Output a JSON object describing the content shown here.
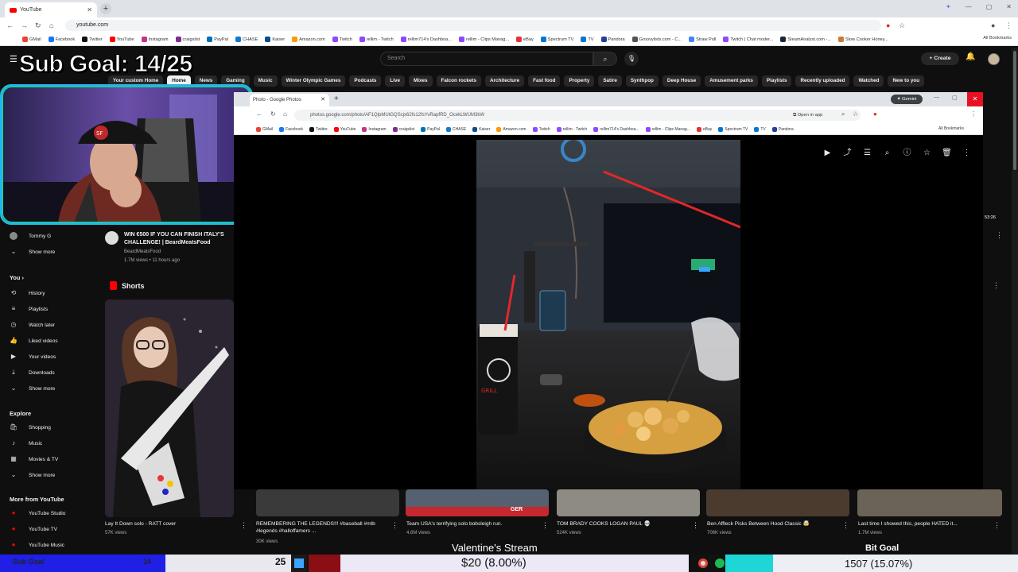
{
  "browser": {
    "tab_title": "YouTube",
    "url": "youtube.com",
    "bookmarks": [
      "GMail",
      "Facebook",
      "Twitter",
      "YouTube",
      "Instagram",
      "craigslist",
      "PayPal",
      "CHASE",
      "Kaiser",
      "Amazon.com",
      "Twitch",
      "rellim - Twitch",
      "rellim714's Dashboa...",
      "rellim - Clips Manag...",
      "eBay",
      "Spectrum TV",
      "TV",
      "Pandora",
      "Groovylists.com - C...",
      "Straw Poll",
      "Twitch | Chat moder...",
      "SteamAnalyst.com -...",
      "Slow Cooker Honey..."
    ],
    "all_bookmarks": "All Bookmarks"
  },
  "youtube": {
    "search_placeholder": "Search",
    "create_label": "Create",
    "chips": [
      "Your custom Home",
      "Home",
      "News",
      "Gaming",
      "Music",
      "Winter Olympic Games",
      "Podcasts",
      "Live",
      "Mixes",
      "Falcon rockets",
      "Architecture",
      "Fast food",
      "Property",
      "Satire",
      "Synthpop",
      "Deep House",
      "Amusement parks",
      "Playlists",
      "Recently uploaded",
      "Watched",
      "New to you"
    ],
    "active_chip_index": 1,
    "sidebar": {
      "subscription": "Tommy G",
      "show_more_1": "Show more",
      "you_heading": "You",
      "you_items": [
        "History",
        "Playlists",
        "Watch later",
        "Liked videos",
        "Your videos",
        "Downloads",
        "Show more"
      ],
      "explore_heading": "Explore",
      "explore_items": [
        "Shopping",
        "Music",
        "Movies & TV",
        "Show more"
      ],
      "more_heading": "More from YouTube",
      "more_items": [
        "YouTube Studio",
        "YouTube TV",
        "YouTube Music"
      ]
    },
    "featured": {
      "title": "WIN €500 IF YOU CAN FINISH ITALY'S CHALLENGE! | BeardMeatsFood",
      "channel": "BeardMeatsFood",
      "meta": "1.7M views • 11 hours ago"
    },
    "right_duration": "53:26",
    "shorts_heading": "Shorts",
    "shorts": [
      {
        "title": "Lay It Down solo - RATT cover",
        "views": "57K views"
      },
      {
        "title": "REMEMBERING THE LEGENDS!!! #baseball #mlb #legends #halloffamers ...",
        "views": "30K views"
      },
      {
        "title": "Team USA's terrifying solo bobsleigh run.",
        "views": "4.6M views"
      },
      {
        "title": "TOM BRADY COOKS LOGAN PAUL 💀",
        "views": "524K views"
      },
      {
        "title": "Ben Affleck Picks Between Hood Classic 🤯",
        "views": "706K views"
      },
      {
        "title": "Last time I showed this, people HATED it...",
        "views": "1.7M views"
      }
    ]
  },
  "overlay": {
    "sub_goal": "Sub Goal: 14/25",
    "bottom_bar": {
      "left_label": "Sub Goal",
      "left_count": "14",
      "sub_target": "25",
      "money": "$20 (8.00%)",
      "bits": "1507 (15.07%)",
      "valentines": "Valentine's Stream",
      "bit_goal": "Bit Goal"
    }
  },
  "photos_window": {
    "tab_title": "Photo - Google Photos",
    "url": "photos.google.com/photo/AF1QipMUtGQScjx62fs12fsYvRapfRD_OcekLWUM3kW",
    "gemini_label": "Gemini",
    "open_in_app": "Open in app",
    "bookmarks": [
      "GMail",
      "Facebook",
      "Twitter",
      "YouTube",
      "Instagram",
      "craigslist",
      "PayPal",
      "CHASE",
      "Kaiser",
      "Amazon.com",
      "Twitch",
      "rellim - Twitch",
      "rellim714's Dashboa...",
      "rellim - Clips Manag...",
      "eBay",
      "Spectrum TV",
      "TV",
      "Pandora"
    ],
    "all_bookmarks": "All Bookmarks",
    "tools": [
      "slideshow-icon",
      "share-icon",
      "edit-icon",
      "zoom-icon",
      "info-icon",
      "star-icon",
      "trash-icon",
      "more-icon"
    ],
    "photo_cup_text": "GRILL"
  },
  "colors": {
    "yt_bg": "#0f0f0f",
    "webcam_border": "#20b8e8",
    "close_red": "#e81123",
    "bar_blue": "#1f1fe6",
    "bar_teal": "#1fd6d6"
  }
}
